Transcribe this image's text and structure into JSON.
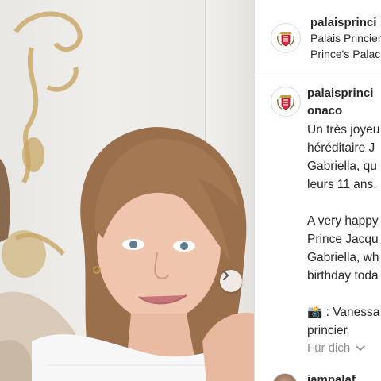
{
  "post": {
    "account": {
      "username": "palaisprinci",
      "display_name_fr": "Palais Princier",
      "display_name_en": "Prince's Palac"
    },
    "caption": {
      "username_line1": "palaisprinci",
      "username_line2": "onaco",
      "lines": [
        "Un très joyeu",
        "héréditaire J",
        "Gabriella, qu",
        "leurs 11 ans.",
        "",
        "A very happy",
        "Prince Jacqu",
        "Gabriella, wh",
        "birthday toda",
        "",
        "📸 : Vanessa",
        "princier"
      ]
    },
    "for_you_label": "Für dich",
    "next_comment_username": "jampalaf"
  },
  "icons": {
    "carousel_next": "chevron-right-icon",
    "dropdown": "chevron-down-icon",
    "avatar": "coat-of-arms-icon"
  },
  "colors": {
    "text": "#262626",
    "muted": "#8e8e8e",
    "divider": "#dbdbdb"
  }
}
